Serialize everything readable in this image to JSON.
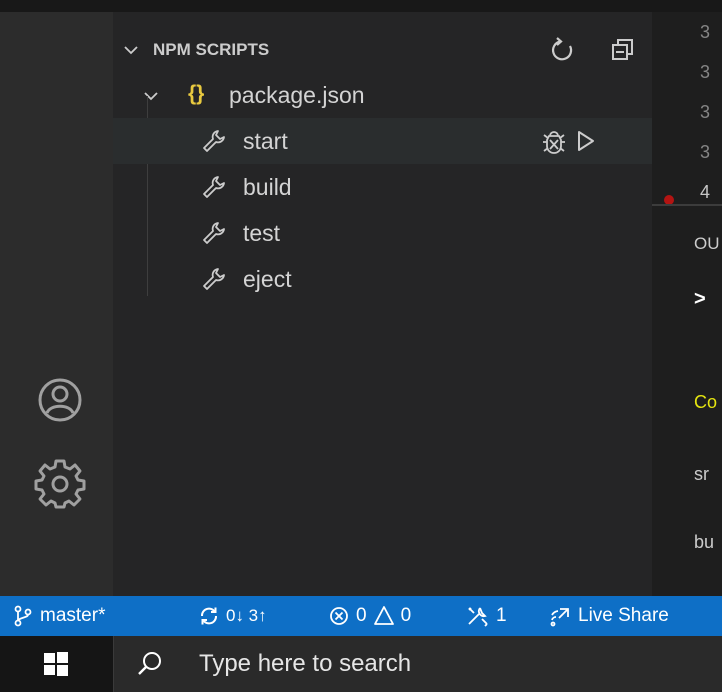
{
  "sidebar": {
    "section_title": "NPM SCRIPTS",
    "package_name": "package.json",
    "package_icon": "{}",
    "scripts": [
      {
        "label": "start"
      },
      {
        "label": "build"
      },
      {
        "label": "test"
      },
      {
        "label": "eject"
      }
    ],
    "icons": {
      "refresh": "refresh-icon",
      "collapse": "collapse-all-icon",
      "debug": "debug-icon",
      "run": "run-icon",
      "wrench": "wrench-icon"
    }
  },
  "editor": {
    "line_numbers": [
      "3",
      "3",
      "3",
      "3",
      "4"
    ]
  },
  "panel": {
    "tab_fragment": "OU",
    "prompt": ">",
    "lines": [
      "Co",
      "sr",
      "bu"
    ],
    "colors": {
      "compiled": "#e5e510",
      "text": "#cccccc"
    }
  },
  "activity_bar": {
    "icons": [
      "account-icon",
      "settings-gear-icon"
    ]
  },
  "status_bar": {
    "branch": "master*",
    "sync": "0↓ 3↑",
    "errors": "0",
    "warnings": "0",
    "tools": "1",
    "live_share": "Live Share",
    "color": "#0e6fc6"
  },
  "taskbar": {
    "search_placeholder": "Type here to search"
  }
}
